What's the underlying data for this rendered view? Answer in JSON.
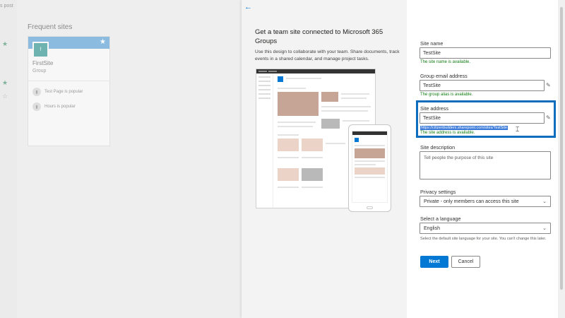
{
  "background": {
    "top_text": "s post",
    "frequent_title": "Frequent sites",
    "site_card": {
      "logo_letter": "f",
      "name": "FirstSite",
      "sub": "Group",
      "activities": [
        "Test Page is popular",
        "Hours is popular"
      ]
    }
  },
  "template": {
    "title": "Get a team site connected to Microsoft 365 Groups",
    "description": "Use this design to collaborate with your team. Share documents, track events in a shared calendar, and manage project tasks."
  },
  "form": {
    "site_name": {
      "label": "Site name",
      "value": "TestSite",
      "status": "The site name is available."
    },
    "group_email": {
      "label": "Group email address",
      "value": "TestSite",
      "status": "The group alias is available."
    },
    "site_address": {
      "label": "Site address",
      "value": "TestSite",
      "url": "https://citizenbuilders.sharepoint.com/sites/TestSite",
      "status": "The site address is available."
    },
    "site_description": {
      "label": "Site description",
      "placeholder": "Tell people the purpose of this site"
    },
    "privacy": {
      "label": "Privacy settings",
      "value": "Private - only members can access this site"
    },
    "language": {
      "label": "Select a language",
      "value": "English",
      "hint": "Select the default site language for your site. You can't change this later."
    },
    "next_label": "Next",
    "cancel_label": "Cancel"
  },
  "colors": {
    "accent": "#0078d4",
    "success": "#107c10",
    "highlight_box": "#0f6cbd"
  }
}
